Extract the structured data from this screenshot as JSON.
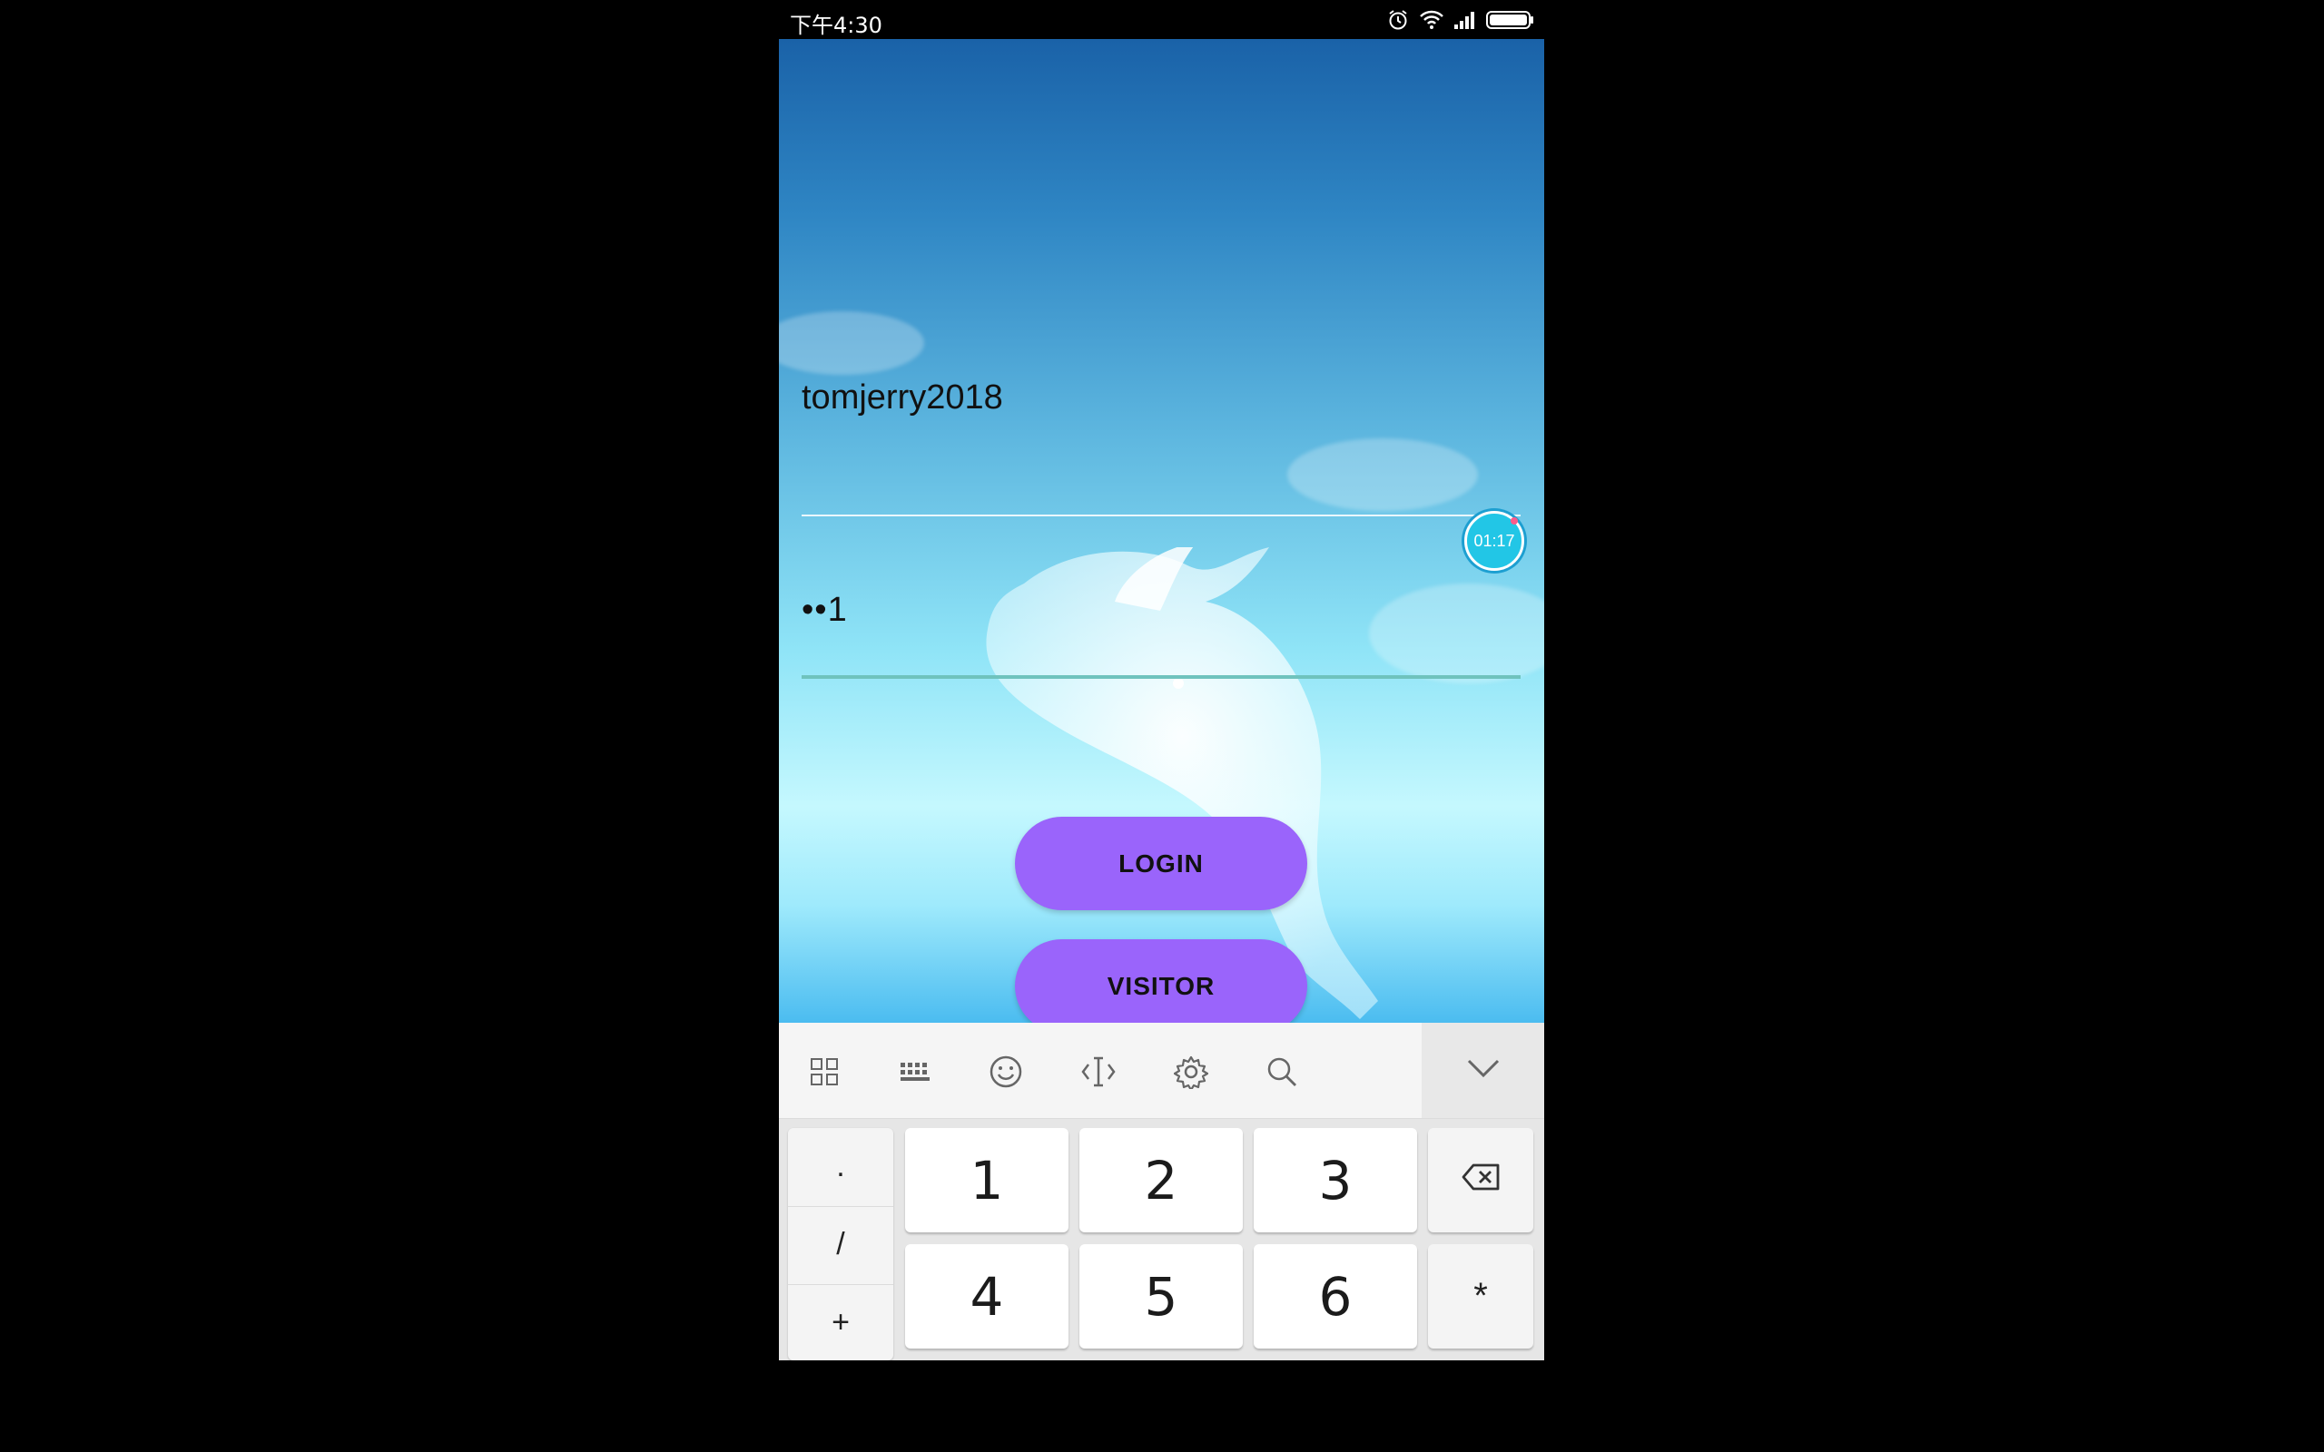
{
  "status_bar": {
    "time": "下午4:30"
  },
  "login_form": {
    "username_value": "tomjerry2018",
    "password_value": "••1",
    "login_label": "LOGIN",
    "visitor_label": "VISITOR"
  },
  "overlay": {
    "timer": "01:17"
  },
  "keyboard": {
    "toolbar_icons": [
      "grid-icon",
      "keyboard-icon",
      "emoji-icon",
      "cursor-icon",
      "settings-gear-icon",
      "search-icon"
    ],
    "side_keys": [
      ".",
      "/",
      "+"
    ],
    "digits": [
      "1",
      "2",
      "3",
      "4",
      "5",
      "6"
    ],
    "star_key": "*"
  },
  "colors": {
    "button": "#9a64fb",
    "timer": "#22c6e6",
    "password_underline": "#6fc3bd"
  }
}
